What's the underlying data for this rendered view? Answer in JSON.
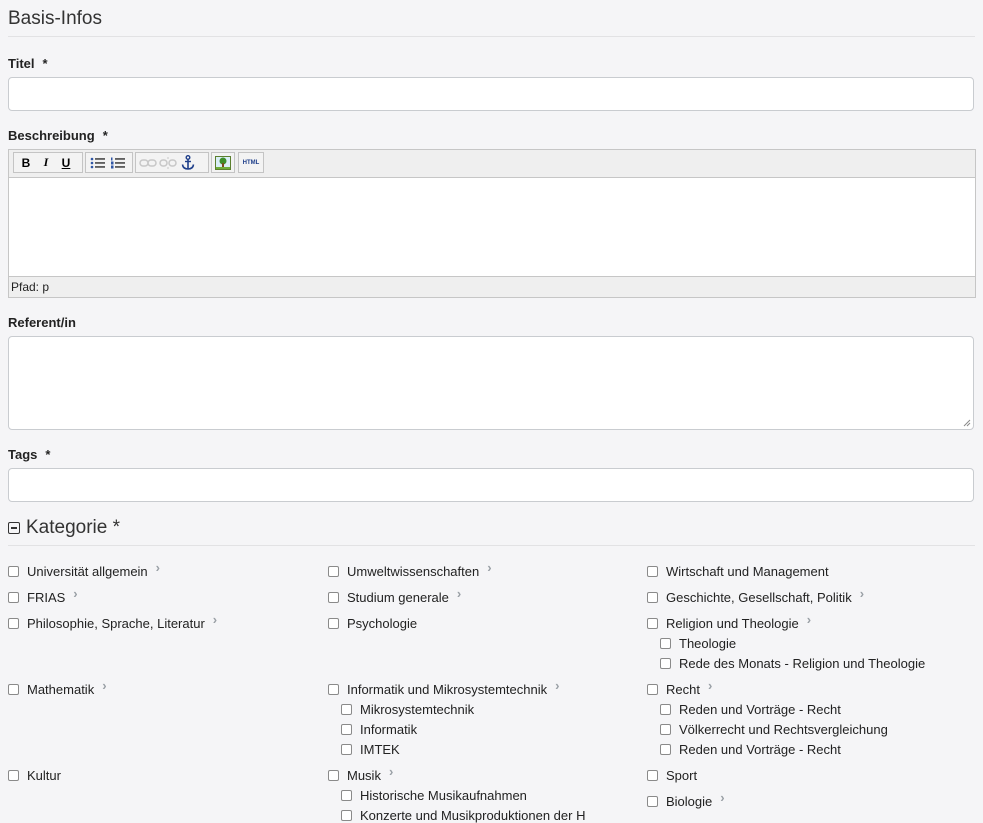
{
  "section_title": "Basis-Infos",
  "fields": {
    "titel": {
      "label": "Titel",
      "required": "*",
      "value": ""
    },
    "beschreibung": {
      "label": "Beschreibung",
      "required": "*",
      "value": "",
      "path": "Pfad: p"
    },
    "referent": {
      "label": "Referent/in",
      "value": ""
    },
    "tags": {
      "label": "Tags",
      "required": "*",
      "value": ""
    }
  },
  "toolbar": {
    "bold": "B",
    "italic": "I",
    "underline": "U",
    "html": "HTML"
  },
  "kategorie": {
    "title": "Kategorie *",
    "col1": [
      "Universität allgemein",
      "FRIAS",
      "Philosophie, Sprache, Literatur",
      "Mathematik",
      "Kultur"
    ],
    "col2": [
      "Umweltwissenschaften",
      "Studium generale",
      "Psychologie",
      "Informatik und Mikrosystemtechnik",
      "Mikrosystemtechnik",
      "Informatik",
      "IMTEK",
      "Musik",
      "Historische Musikaufnahmen",
      "Konzerte und Musikproduktionen der H"
    ],
    "col3": [
      "Wirtschaft und Management",
      "Geschichte, Gesellschaft, Politik",
      "Religion und Theologie",
      "Theologie",
      "Rede des Monats - Religion und Theologie",
      "Recht",
      "Reden und Vorträge - Recht",
      "Völkerrecht und Rechtsvergleichung",
      "Reden und Vorträge - Recht",
      "Sport",
      "Biologie"
    ]
  },
  "colors": {
    "background": "#f5f5f7",
    "border": "#c9ccd0",
    "chevron": "#9aa0a6"
  }
}
